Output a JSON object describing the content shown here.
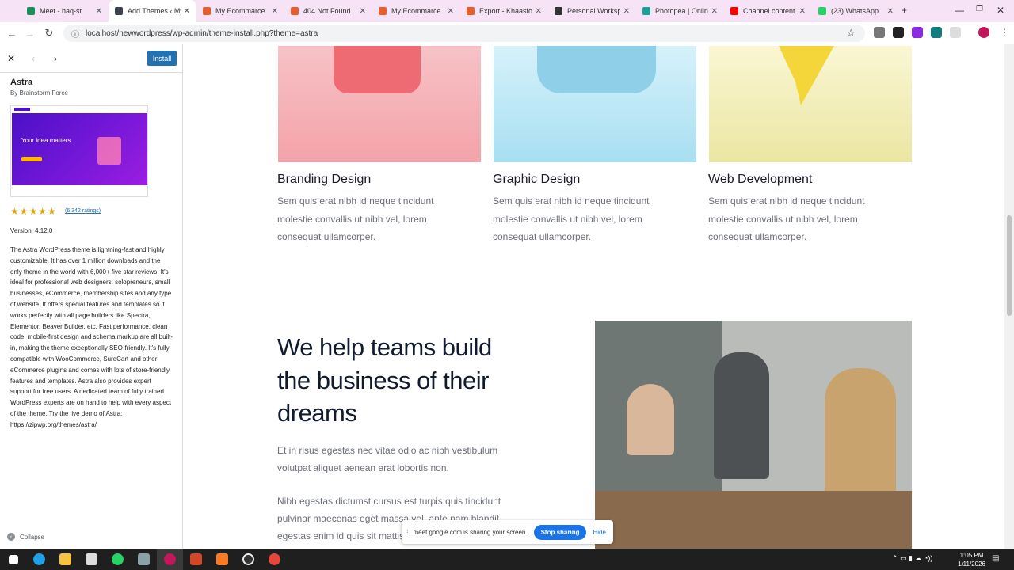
{
  "browser": {
    "tabs": [
      {
        "title": "Meet - haq-st",
        "color": "#1a8f5a"
      },
      {
        "title": "Add Themes ‹ My",
        "color": "#3c434a"
      },
      {
        "title": "My Ecommarce",
        "color": "#e85d2a"
      },
      {
        "title": "404 Not Found",
        "color": "#e85d2a"
      },
      {
        "title": "My Ecommarce",
        "color": "#e85d2a"
      },
      {
        "title": "Export - Khaasfoo",
        "color": "#e85d2a"
      },
      {
        "title": "Personal Workspa",
        "color": "#333"
      },
      {
        "title": "Photopea | Online",
        "color": "#18a497"
      },
      {
        "title": "Channel content",
        "color": "#ff0000"
      },
      {
        "title": "(23) WhatsApp",
        "color": "#25d366"
      }
    ],
    "url": "localhost/newwordpress/wp-admin/theme-install.php?theme=astra"
  },
  "sidebar": {
    "install_label": "Install",
    "theme_name": "Astra",
    "author": "By Brainstorm Force",
    "screenshot_headline": "Your idea matters",
    "stars": "★★★★★",
    "ratings": "(6,342 ratings)",
    "version": "Version: 4.12.0",
    "description": "The Astra WordPress theme is lightning-fast and highly customizable. It has over 1 million downloads and the only theme in the world with 6,000+ five star reviews! It's ideal for professional web designers, solopreneurs, small businesses, eCommerce, membership sites and any type of website. It offers special features and templates so it works perfectly with all page builders like Spectra, Elementor, Beaver Builder, etc. Fast performance, clean code, mobile-first design and schema markup are all built-in, making the theme exceptionally SEO-friendly. It's fully compatible with WooCommerce, SureCart and other eCommerce plugins and comes with lots of store-friendly features and templates. Astra also provides expert support for free users. A dedicated team of fully trained WordPress experts are on hand to help with every aspect of the theme. Try the live demo of Astra: https://zipwp.org/themes/astra/",
    "collapse_label": "Collapse"
  },
  "preview": {
    "cards": [
      {
        "title": "Branding Design",
        "text": "Sem quis erat nibh id neque tincidunt molestie convallis ut nibh vel, lorem consequat ullamcorper."
      },
      {
        "title": "Graphic Design",
        "text": "Sem quis erat nibh id neque tincidunt molestie convallis ut nibh vel, lorem consequat ullamcorper."
      },
      {
        "title": "Web Development",
        "text": "Sem quis erat nibh id neque tincidunt molestie convallis ut nibh vel, lorem consequat ullamcorper."
      }
    ],
    "heading": "We help teams build the business of their dreams",
    "para1": "Et in risus egestas nec vitae odio ac nibh vestibulum volutpat aliquet aenean erat lobortis non.",
    "para2": "Nibh egestas dictumst cursus est turpis quis tincidunt pulvinar maecenas eget massa vel, ante nam blandit egestas enim id quis sit mattis."
  },
  "screen_share": {
    "message": "meet.google.com is sharing your screen.",
    "stop_label": "Stop sharing",
    "hide_label": "Hide"
  },
  "taskbar": {
    "time": "1:05 PM",
    "date": "1/11/2026"
  }
}
